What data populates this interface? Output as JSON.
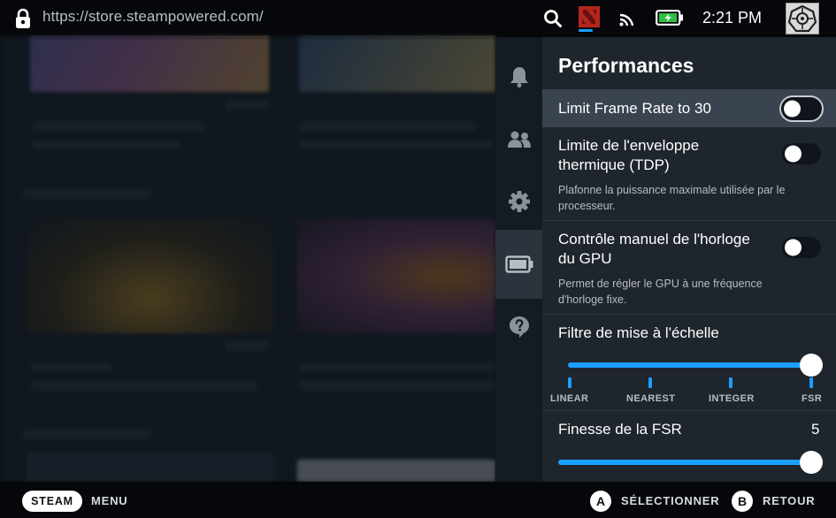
{
  "topbar": {
    "url": "https://store.steampowered.com/",
    "time": "2:21 PM"
  },
  "rail": {
    "items": [
      {
        "icon": "bell-icon"
      },
      {
        "icon": "friends-icon"
      },
      {
        "icon": "gear-icon"
      },
      {
        "icon": "battery-icon",
        "active": true
      },
      {
        "icon": "help-icon"
      }
    ]
  },
  "panel": {
    "title": "Performances",
    "limit_fps": {
      "label": "Limit Frame Rate to 30",
      "on": false
    },
    "tdp": {
      "label_line1": "Limite de l'enveloppe",
      "label_line2": "thermique (TDP)",
      "desc_line1": "Plafonne la puissance maximale utilisée par le",
      "desc_line2": "processeur.",
      "on": false
    },
    "gpu": {
      "label_line1": "Contrôle manuel de l'horloge",
      "label_line2": "du GPU",
      "desc_line1": "Permet de régler le GPU à une fréquence",
      "desc_line2": "d'horloge fixe.",
      "on": false
    },
    "scaling": {
      "label": "Filtre de mise à l'échelle",
      "options": [
        "LINEAR",
        "NEAREST",
        "INTEGER",
        "FSR"
      ],
      "selected": "FSR"
    },
    "fsr": {
      "label": "Finesse de la FSR",
      "value": "5",
      "level": 1.0
    }
  },
  "bottombar": {
    "steam": "STEAM",
    "menu": "MENU",
    "a": "A",
    "select": "SÉLECTIONNER",
    "b": "B",
    "back": "RETOUR"
  },
  "colors": {
    "accent": "#1a9fff",
    "panel_bg": "#1e252d",
    "highlight": "#3a4350",
    "topbar": "#05070a"
  }
}
